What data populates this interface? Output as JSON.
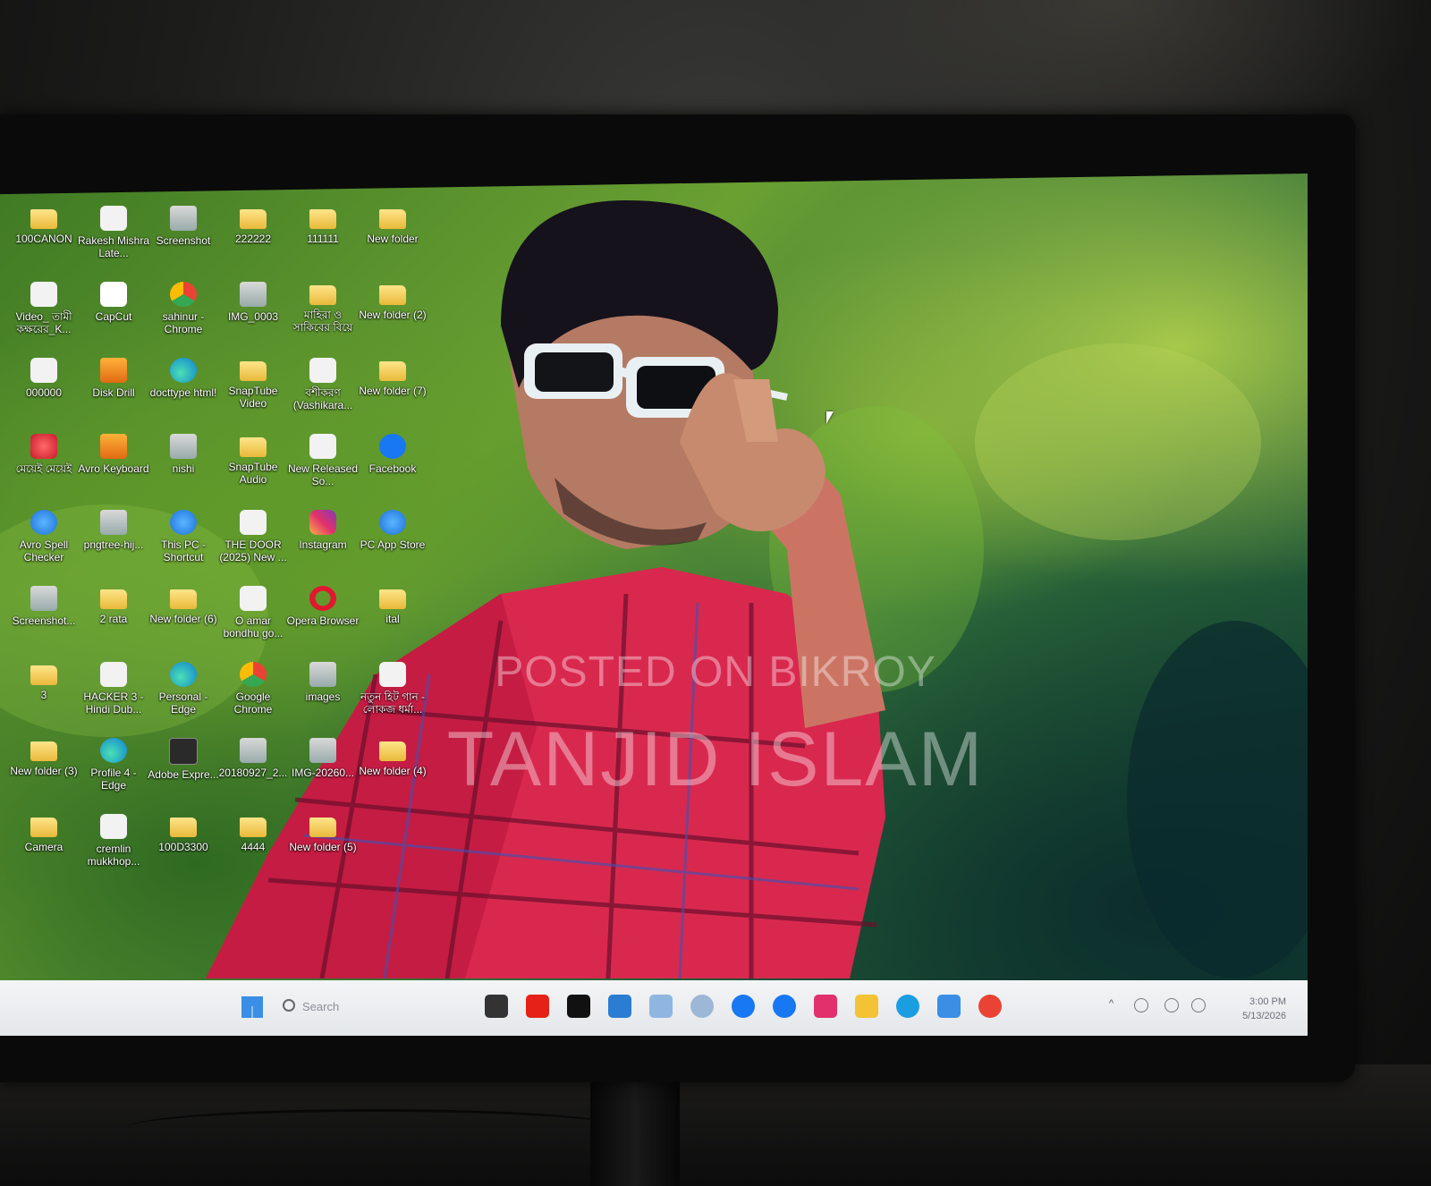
{
  "desktop": {
    "icons": [
      {
        "label": "100CANON",
        "icon": "folder-icon"
      },
      {
        "label": "Rakesh Mishra Late...",
        "icon": "video-file-icon"
      },
      {
        "label": "Screenshot",
        "icon": "image-file-icon"
      },
      {
        "label": "222222",
        "icon": "folder-icon"
      },
      {
        "label": "111111",
        "icon": "folder-icon"
      },
      {
        "label": "New folder",
        "icon": "folder-icon"
      },
      {
        "label": "Video_ তামী কক্ষরের_K...",
        "icon": "video-file-icon"
      },
      {
        "label": "CapCut",
        "icon": "capcut-icon"
      },
      {
        "label": "sahinur - Chrome",
        "icon": "chrome-icon"
      },
      {
        "label": "IMG_0003",
        "icon": "image-file-icon"
      },
      {
        "label": "মাহিরা ও সাকিবের বিয়ে",
        "icon": "folder-icon"
      },
      {
        "label": "New folder (2)",
        "icon": "folder-icon"
      },
      {
        "label": "000000",
        "icon": "video-file-icon"
      },
      {
        "label": "Disk Drill",
        "icon": "disk-drill-icon"
      },
      {
        "label": "docttype html!",
        "icon": "edge-icon"
      },
      {
        "label": "SnapTube Video",
        "icon": "folder-icon"
      },
      {
        "label": "বশীকরণ (Vashikara...",
        "icon": "video-file-icon"
      },
      {
        "label": "New folder (7)",
        "icon": "folder-icon"
      },
      {
        "label": "মেয়েই মেয়েই",
        "icon": "app-icon"
      },
      {
        "label": "Avro Keyboard",
        "icon": "avro-keyboard-icon"
      },
      {
        "label": "nishi",
        "icon": "image-file-icon"
      },
      {
        "label": "SnapTube Audio",
        "icon": "folder-icon"
      },
      {
        "label": "New Released So...",
        "icon": "video-file-icon"
      },
      {
        "label": "Facebook",
        "icon": "facebook-icon"
      },
      {
        "label": "Avro Spell Checker",
        "icon": "avro-spell-icon"
      },
      {
        "label": "pngtree-hij...",
        "icon": "image-file-icon"
      },
      {
        "label": "This PC - Shortcut",
        "icon": "this-pc-icon"
      },
      {
        "label": "THE DOOR (2025) New ...",
        "icon": "video-file-icon"
      },
      {
        "label": "Instagram",
        "icon": "instagram-icon"
      },
      {
        "label": "PC App Store",
        "icon": "pc-app-store-icon"
      },
      {
        "label": "Screenshot...",
        "icon": "image-file-icon"
      },
      {
        "label": "2 rata",
        "icon": "folder-icon"
      },
      {
        "label": "New folder (6)",
        "icon": "folder-icon"
      },
      {
        "label": "O amar bondhu go...",
        "icon": "video-file-icon"
      },
      {
        "label": "Opera Browser",
        "icon": "opera-icon"
      },
      {
        "label": "ital",
        "icon": "folder-icon"
      },
      {
        "label": "3",
        "icon": "folder-icon"
      },
      {
        "label": "HACKER 3 - Hindi Dub...",
        "icon": "video-file-icon"
      },
      {
        "label": "Personal - Edge",
        "icon": "edge-icon"
      },
      {
        "label": "Google Chrome",
        "icon": "chrome-icon"
      },
      {
        "label": "images",
        "icon": "image-file-icon"
      },
      {
        "label": "নতুন হিট গান - লোকজ ধর্মা...",
        "icon": "video-file-icon"
      },
      {
        "label": "New folder (3)",
        "icon": "folder-icon"
      },
      {
        "label": "Profile 4 - Edge",
        "icon": "edge-icon"
      },
      {
        "label": "Adobe Expre...",
        "icon": "adobe-express-icon"
      },
      {
        "label": "20180927_2...",
        "icon": "image-file-icon"
      },
      {
        "label": "IMG-20260...",
        "icon": "image-file-icon"
      },
      {
        "label": "New folder (4)",
        "icon": "folder-icon"
      },
      {
        "label": "Camera",
        "icon": "folder-icon"
      },
      {
        "label": "cremlin mukkhop...",
        "icon": "video-file-icon"
      },
      {
        "label": "100D3300",
        "icon": "folder-icon"
      },
      {
        "label": "4444",
        "icon": "folder-icon"
      },
      {
        "label": "New folder (5)",
        "icon": "folder-icon"
      }
    ]
  },
  "taskbar": {
    "search_placeholder": "Search",
    "apps": [
      {
        "name": "task-view-icon",
        "color": "#333333"
      },
      {
        "name": "youtube-icon",
        "color": "#e62117"
      },
      {
        "name": "netflix-icon",
        "color": "#111111"
      },
      {
        "name": "microsoft-store-icon",
        "color": "#2b7cd3"
      },
      {
        "name": "photos-icon",
        "color": "#8fb6e0"
      },
      {
        "name": "copilot-icon",
        "color": "#9db7d6"
      },
      {
        "name": "facebook-icon",
        "color": "#1877f2"
      },
      {
        "name": "facebook-icon",
        "color": "#1877f2"
      },
      {
        "name": "instagram-icon",
        "color": "#e1306c"
      },
      {
        "name": "file-explorer-icon",
        "color": "#f3c235"
      },
      {
        "name": "edge-icon",
        "color": "#1b9de2"
      },
      {
        "name": "telegram-icon",
        "color": "#3a8ee6"
      },
      {
        "name": "chrome-icon",
        "color": "#ea4335"
      }
    ],
    "clock_time": "3:00 PM",
    "clock_date": "5/13/2026"
  },
  "watermark": {
    "line1": "POSTED ON BIKROY",
    "line2": "TANJID ISLAM"
  }
}
